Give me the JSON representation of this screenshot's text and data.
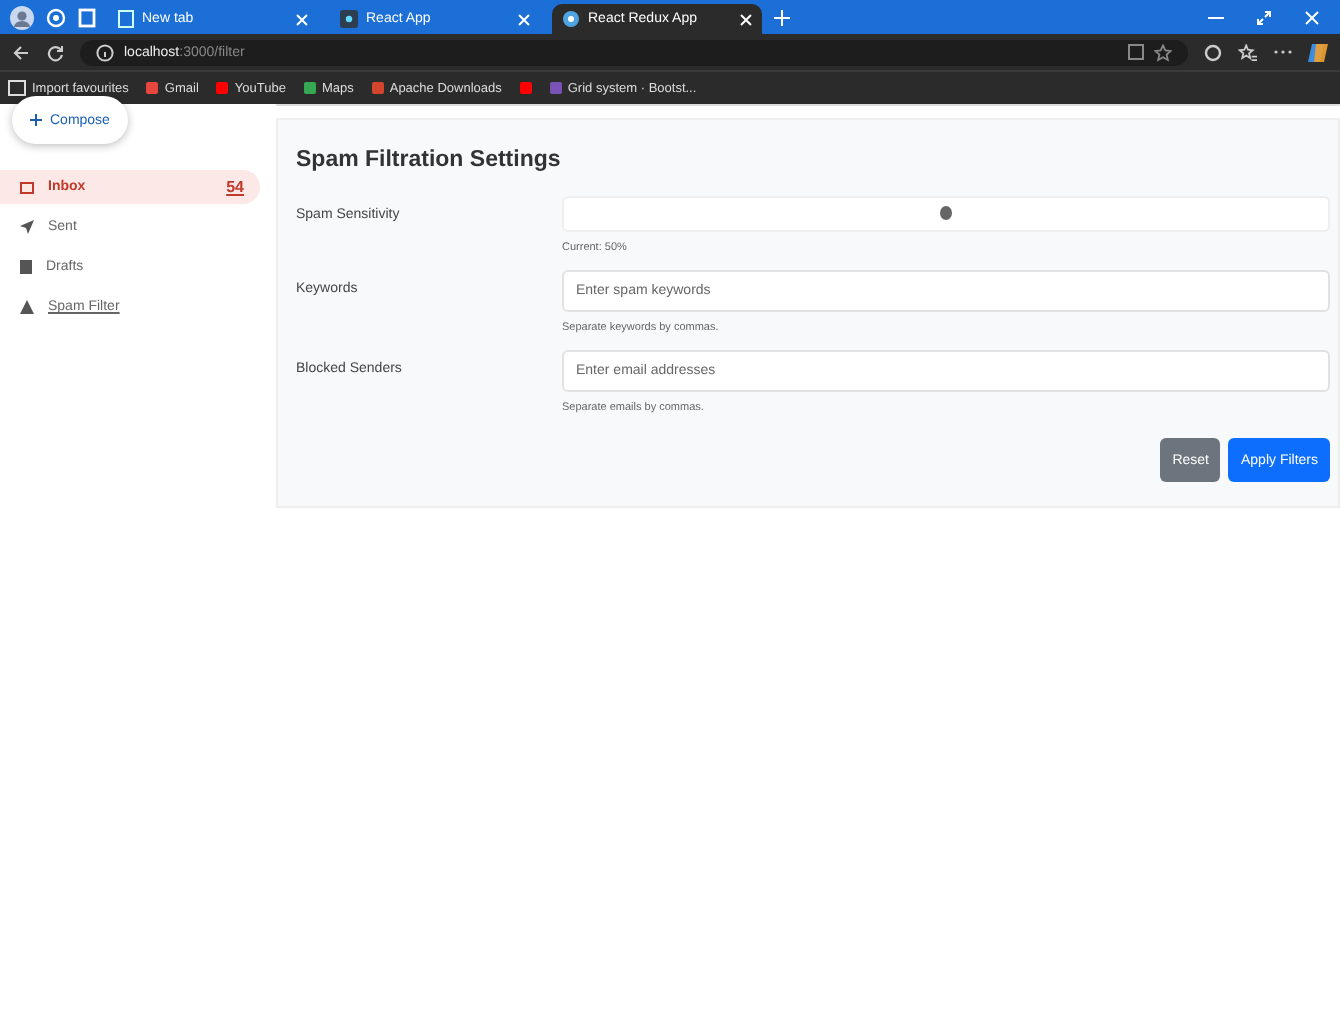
{
  "browser": {
    "tabs": [
      {
        "title": "New tab",
        "kind": "page",
        "selected": false
      },
      {
        "title": "React App",
        "kind": "react",
        "selected": false
      },
      {
        "title": "React Redux App",
        "kind": "globe",
        "selected": true
      }
    ],
    "address": {
      "host": "localhost",
      "path": ":3000/filter"
    },
    "bookmarks": [
      {
        "label": "Import favourites",
        "kind": "folder"
      },
      {
        "label": "Gmail",
        "kind": "mail"
      },
      {
        "label": "YouTube",
        "kind": "video"
      },
      {
        "label": "Maps",
        "kind": "pin"
      },
      {
        "label": "Apache Downloads",
        "kind": "feather"
      },
      {
        "kind": "video"
      },
      {
        "label": "Grid system · Bootst...",
        "kind": "bootstrap"
      }
    ]
  },
  "sidebar": {
    "compose": "Compose",
    "items": [
      {
        "label": "Inbox",
        "kind": "inbox",
        "selected": true,
        "badge": "54"
      },
      {
        "label": "Sent",
        "kind": "sent",
        "selected": false
      },
      {
        "label": "Drafts",
        "kind": "drafts",
        "selected": false
      },
      {
        "label": "Spam Filter",
        "kind": "filter",
        "selected": false
      }
    ]
  },
  "settings": {
    "title": "Spam Filtration Settings",
    "sensitivity": {
      "label": "Spam Sensitivity",
      "level": 0.5,
      "reading": "Current: 50%"
    },
    "fields": [
      {
        "label": "Keywords",
        "placeholder": "Enter spam keywords",
        "help": "Separate keywords by commas."
      },
      {
        "label": "Blocked Senders",
        "placeholder": "Enter email addresses",
        "help": "Separate emails by commas."
      }
    ],
    "buttons": [
      {
        "label": "Reset",
        "kind": "secondary"
      },
      {
        "label": "Apply Filters",
        "kind": "primary"
      }
    ]
  }
}
